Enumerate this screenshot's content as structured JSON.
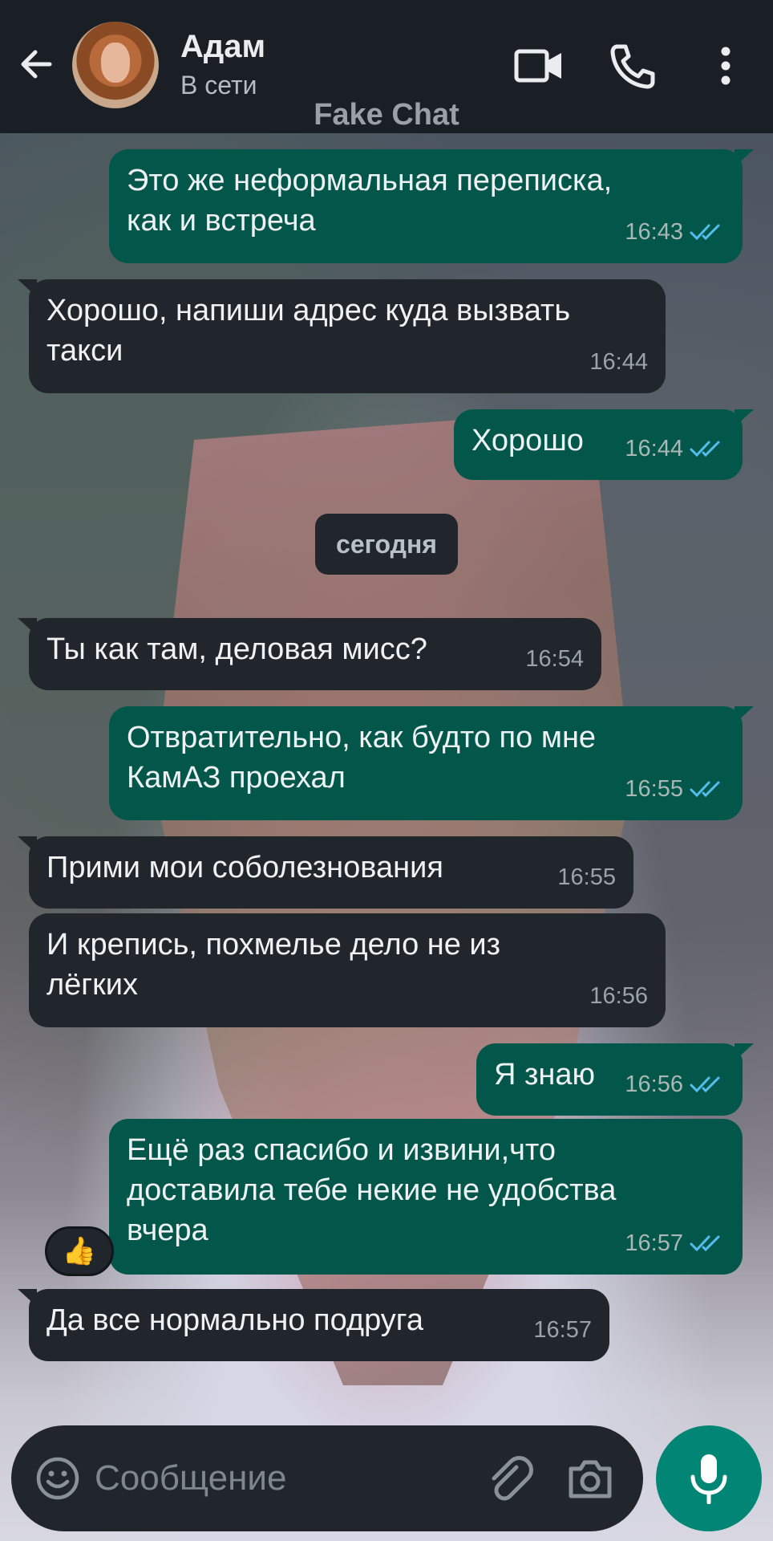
{
  "header": {
    "contact_name": "Адам",
    "status": "В сети",
    "watermark": "Fake Chat"
  },
  "date_separator": "сегодня",
  "messages": [
    {
      "dir": "out",
      "text": "Это же неформальная переписка,\nкак и встреча",
      "time": "16:43",
      "read": true
    },
    {
      "dir": "in",
      "text": "Хорошо, напиши адрес куда вызвать\nтакси",
      "time": "16:44"
    },
    {
      "dir": "out",
      "text": "Хорошо",
      "time": "16:44",
      "read": true
    },
    {
      "dir": "in",
      "text": "Ты как там, деловая мисс?",
      "time": "16:54"
    },
    {
      "dir": "out",
      "text": "Отвратительно, как будто по мне\nКамАЗ проехал",
      "time": "16:55",
      "read": true
    },
    {
      "dir": "in",
      "text": "Прими мои соболезнования",
      "time": "16:55"
    },
    {
      "dir": "in",
      "text": "И крепись, похмелье дело не из\nлёгких",
      "time": "16:56"
    },
    {
      "dir": "out",
      "text": "Я знаю",
      "time": "16:56",
      "read": true
    },
    {
      "dir": "out",
      "text": "Ещё раз спасибо и извини,что\nдоставила тебе некие не удобства\nвчера",
      "time": "16:57",
      "read": true
    },
    {
      "dir": "in",
      "text": "Да все нормально подруга",
      "time": "16:57"
    }
  ],
  "reaction": "👍",
  "composer": {
    "placeholder": "Сообщение",
    "value": ""
  },
  "colors": {
    "header_bg": "#1a1f26",
    "outgoing_bubble": "#03574a",
    "incoming_bubble": "#20262c",
    "read_tick": "#53bdeb",
    "mic_button": "#018575"
  },
  "icons": [
    "back-arrow-icon",
    "video-call-icon",
    "phone-icon",
    "more-vert-icon",
    "emoji-icon",
    "attach-icon",
    "camera-icon",
    "mic-icon",
    "double-check-icon"
  ]
}
